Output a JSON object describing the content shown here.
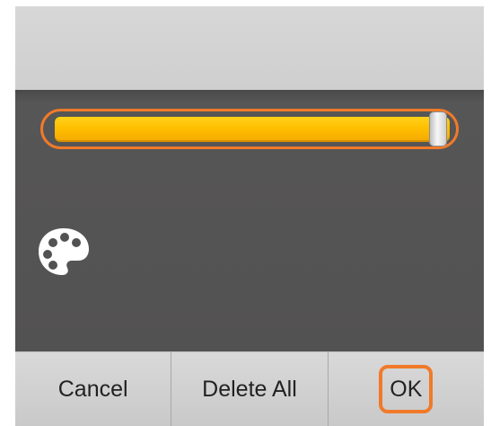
{
  "dialog": {
    "slider": {
      "value_fraction": 1.0,
      "track_color": "#ffbf00",
      "highlight_color": "#f07a2a"
    },
    "palette_icon": "palette-icon"
  },
  "buttons": {
    "cancel_label": "Cancel",
    "delete_all_label": "Delete All",
    "ok_label": "OK"
  }
}
